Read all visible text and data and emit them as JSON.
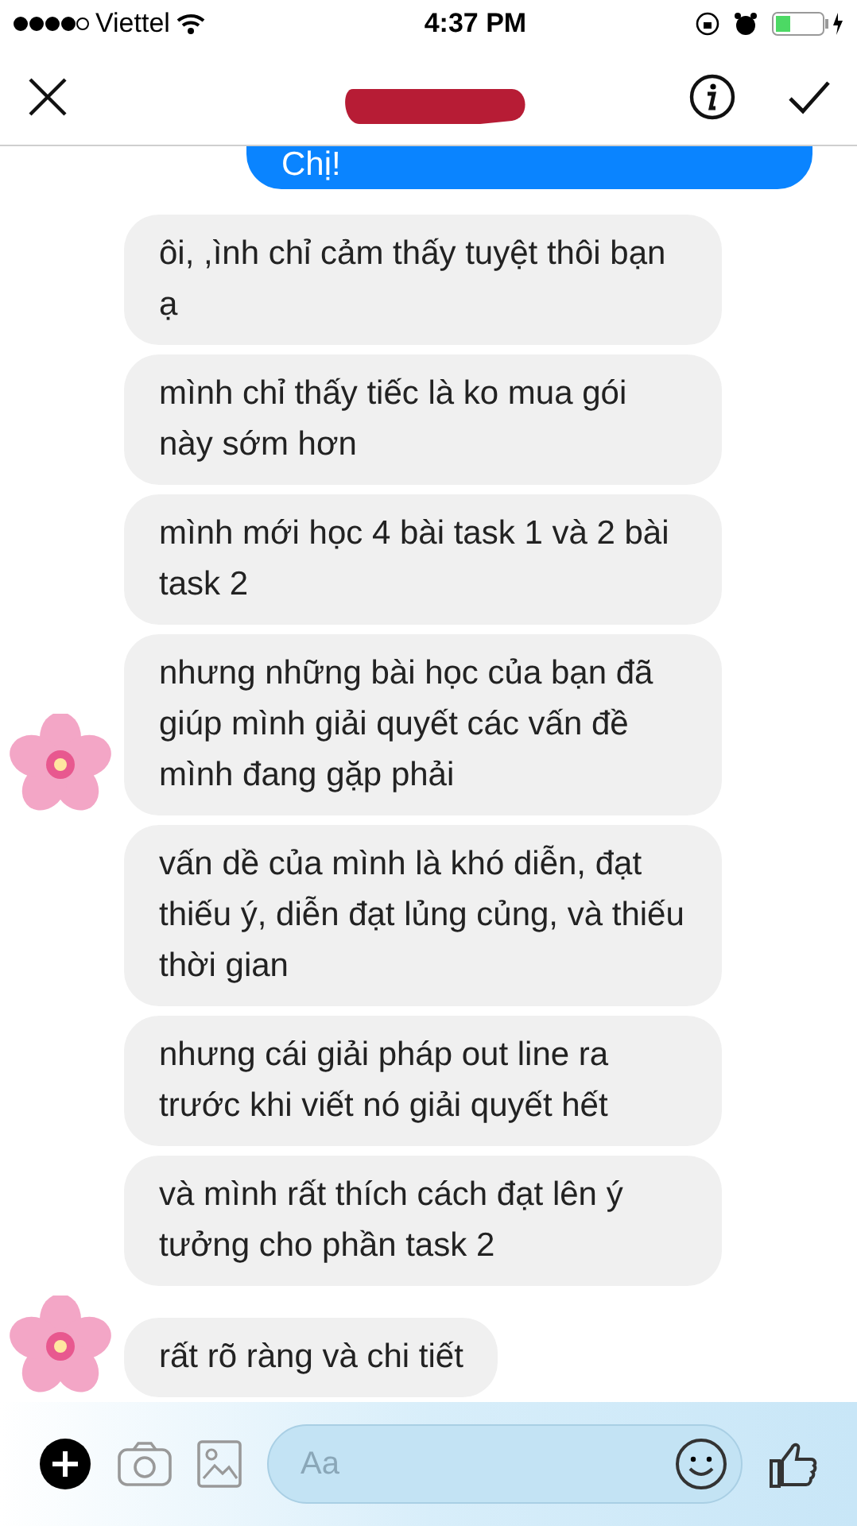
{
  "status_bar": {
    "carrier": "Viettel",
    "time": "4:37 PM"
  },
  "outgoing": {
    "text": "Chị!"
  },
  "messages": [
    {
      "text": "ôi, ,ình chỉ cảm thấy tuyệt thôi bạn ạ",
      "avatar": false
    },
    {
      "text": "mình chỉ thấy tiếc là ko mua gói này sớm hơn",
      "avatar": false
    },
    {
      "text": "mình mới học 4 bài task 1 và 2 bài task 2",
      "avatar": false
    },
    {
      "text": "nhưng những bài học của bạn đã giúp mình giải quyết các vấn đề mình đang gặp phải",
      "avatar": true
    },
    {
      "text": "vấn dề của mình là khó diễn, đạt thiếu ý, diễn đạt lủng củng, và thiếu thời gian",
      "avatar": false
    },
    {
      "text": "nhưng cái giải pháp out line ra trước khi viết nó giải quyết hết",
      "avatar": false
    },
    {
      "text": "và mình rất thích cách đạt lên ý tưởng cho phần task 2",
      "avatar": false
    },
    {
      "text": "rất rõ ràng và chi tiết",
      "avatar": true
    }
  ],
  "composer": {
    "placeholder": "Aa"
  }
}
